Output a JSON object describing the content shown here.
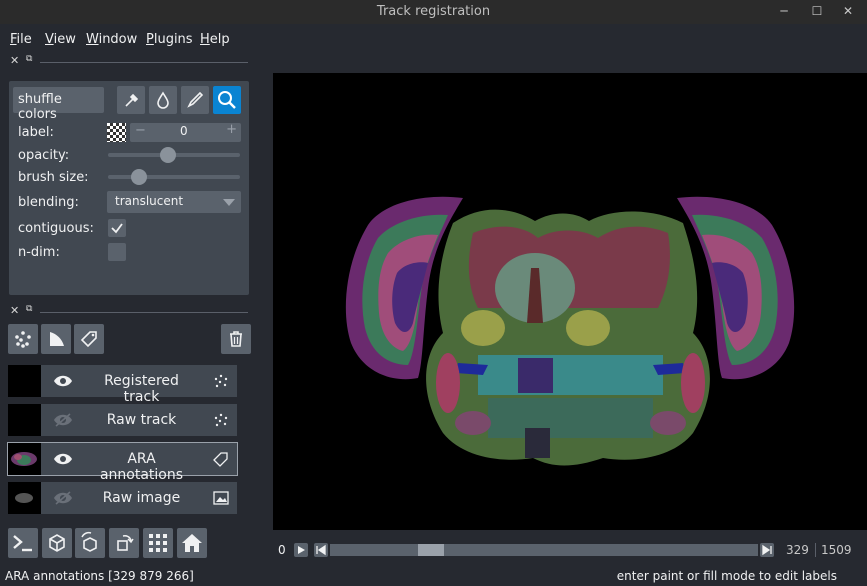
{
  "window": {
    "title": "Track registration"
  },
  "menu": [
    {
      "label": "File",
      "underline": "F",
      "rest": "ile"
    },
    {
      "label": "View",
      "underline": "V",
      "rest": "iew"
    },
    {
      "label": "Window",
      "underline": "W",
      "rest": "indow"
    },
    {
      "label": "Plugins",
      "underline": "P",
      "rest": "lugins"
    },
    {
      "label": "Help",
      "underline": "H",
      "rest": "elp"
    }
  ],
  "layer_controls": {
    "shuffle_label": "shuffle colors",
    "label_text": "label:",
    "label_value": "0",
    "minus": "−",
    "plus": "+",
    "opacity_text": "opacity:",
    "opacity_value": 0.45,
    "brush_text": "brush size:",
    "brush_value": 0.2,
    "blending_text": "blending:",
    "blending_value": "translucent",
    "contiguous_text": "contiguous:",
    "contiguous_checked": true,
    "ndim_text": "n-dim:",
    "ndim_checked": false,
    "tools": [
      "picker-icon",
      "fill-icon",
      "paint-icon",
      "zoom-icon"
    ],
    "active_tool_color": "#0a84d2"
  },
  "layers": [
    {
      "name": "Registered track",
      "visible": true,
      "type_icon": "points-icon"
    },
    {
      "name": "Raw track",
      "visible": false,
      "type_icon": "points-icon"
    },
    {
      "name": "ARA annotations",
      "visible": true,
      "type_icon": "labels-icon",
      "selected": true
    },
    {
      "name": "Raw image",
      "visible": false,
      "type_icon": "image-icon"
    }
  ],
  "dims": {
    "start": "0",
    "current": "329",
    "max": "1509",
    "position_fraction": 0.218
  },
  "status": {
    "left": "ARA annotations [329 879 266]",
    "right": "enter paint or fill mode to edit labels"
  },
  "colors": {
    "background": "#262930",
    "panel": "#414851",
    "button": "#5a626c",
    "accent": "#0a84d2"
  }
}
